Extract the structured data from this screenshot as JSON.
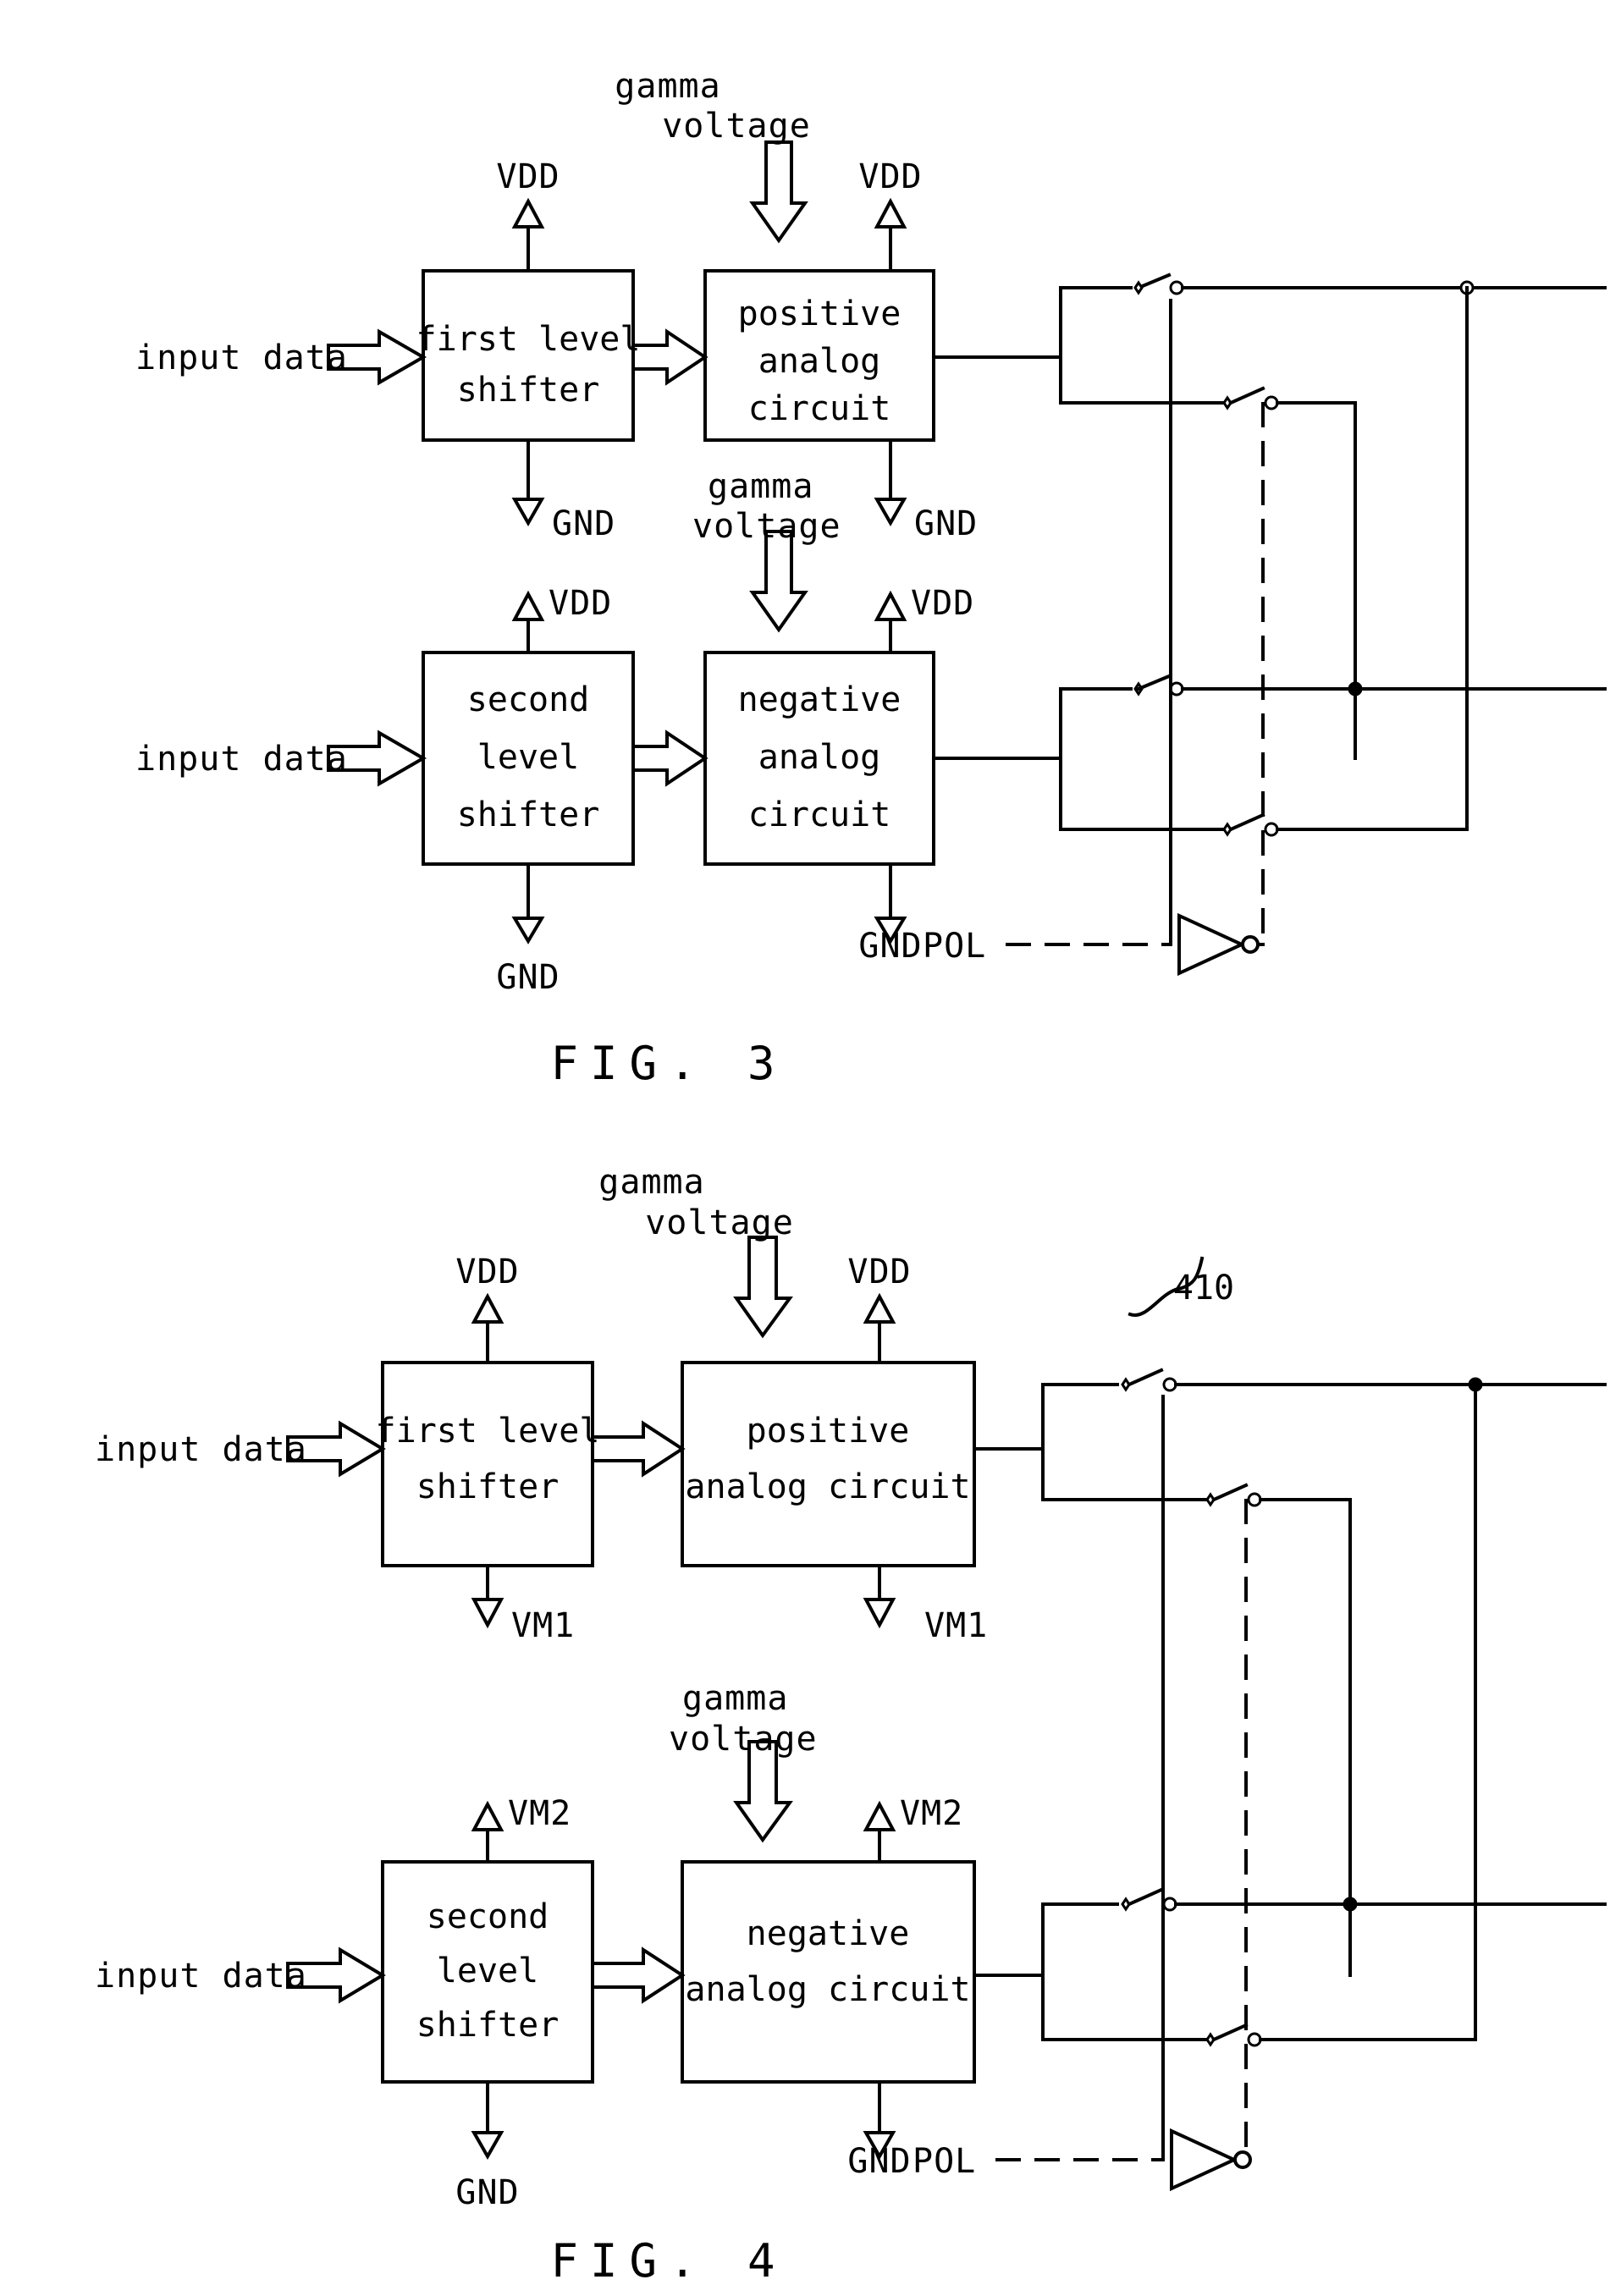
{
  "document": {
    "type": "patent-figure-sheet",
    "figures": [
      {
        "id": "fig3",
        "caption": "FIG. 3",
        "blocks": [
          {
            "name": "first-level-shifter",
            "lines": [
              "first level",
              "shifter"
            ]
          },
          {
            "name": "positive-analog-circuit",
            "lines": [
              "positive",
              "analog",
              "circuit"
            ]
          },
          {
            "name": "second-level-shifter",
            "lines": [
              "second",
              "level",
              "shifter"
            ]
          },
          {
            "name": "negative-analog-circuit",
            "lines": [
              "negative",
              "analog",
              "circuit"
            ]
          }
        ],
        "labels": {
          "input_data_top": "input data",
          "input_data_bottom": "input data",
          "gamma_voltage_top": [
            "gamma",
            "voltage"
          ],
          "gamma_voltage_bottom": [
            "gamma",
            "voltage"
          ],
          "vdd_ls1": "VDD",
          "vdd_pac": "VDD",
          "gnd_ls1": "GND",
          "gnd_pac": "GND",
          "vdd_ls2": "VDD",
          "vdd_nac": "VDD",
          "gnd_ls2": "GND",
          "gnd_nac": "GND",
          "pol": "POL"
        }
      },
      {
        "id": "fig4",
        "caption": "FIG. 4",
        "reference_numeral": "410",
        "blocks": [
          {
            "name": "first-level-shifter",
            "lines": [
              "first level",
              "shifter"
            ]
          },
          {
            "name": "positive-analog-circuit",
            "lines": [
              "positive",
              "analog circuit"
            ]
          },
          {
            "name": "second-level-shifter",
            "lines": [
              "second",
              "level",
              "shifter"
            ]
          },
          {
            "name": "negative-analog-circuit",
            "lines": [
              "negative",
              "analog circuit"
            ]
          }
        ],
        "labels": {
          "input_data_top": "input data",
          "input_data_bottom": "input data",
          "gamma_voltage_top": [
            "gamma",
            "voltage"
          ],
          "gamma_voltage_bottom": [
            "gamma",
            "voltage"
          ],
          "vdd_ls1": "VDD",
          "vdd_pac": "VDD",
          "vm1_ls1": "VM1",
          "vm1_pac": "VM1",
          "vm2_ls2": "VM2",
          "vm2_nac": "VM2",
          "gnd_ls2": "GND",
          "gnd_nac": "GND",
          "pol": "POL"
        }
      }
    ],
    "colors": {
      "ink": "#000000",
      "paper": "#ffffff"
    }
  }
}
